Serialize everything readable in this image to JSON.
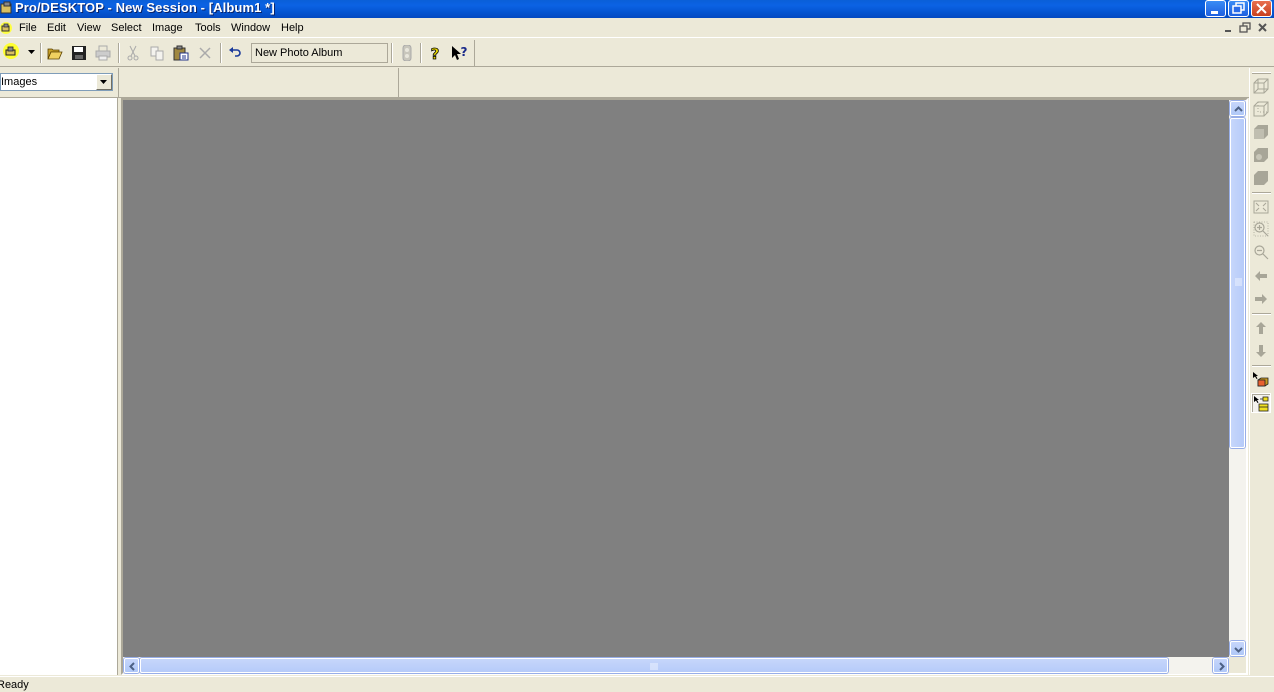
{
  "window": {
    "title": "Pro/DESKTOP - New Session - [Album1 *]",
    "controls": [
      "minimize",
      "restore",
      "close"
    ]
  },
  "menubar": {
    "items": [
      "File",
      "Edit",
      "View",
      "Select",
      "Image",
      "Tools",
      "Window",
      "Help"
    ],
    "mdi_controls": [
      "minimize",
      "restore",
      "close"
    ]
  },
  "toolbar": {
    "buttons": [
      {
        "name": "session-menu",
        "icon": "pro-desktop-logo-icon",
        "enabled": true
      },
      {
        "name": "open",
        "icon": "folder-open-icon",
        "enabled": true
      },
      {
        "name": "save",
        "icon": "floppy-disk-icon",
        "enabled": true
      },
      {
        "name": "print",
        "icon": "printer-icon",
        "enabled": false
      },
      {
        "name": "cut",
        "icon": "scissors-icon",
        "enabled": false
      },
      {
        "name": "copy",
        "icon": "copy-icon",
        "enabled": false
      },
      {
        "name": "paste",
        "icon": "clipboard-icon",
        "enabled": true
      },
      {
        "name": "delete",
        "icon": "delete-x-icon",
        "enabled": false
      },
      {
        "name": "undo",
        "icon": "undo-icon",
        "enabled": true
      },
      {
        "name": "traffic-light",
        "icon": "traffic-light-icon",
        "enabled": false
      },
      {
        "name": "help",
        "icon": "help-question-icon",
        "enabled": true
      },
      {
        "name": "context-help",
        "icon": "context-help-icon",
        "enabled": true
      }
    ],
    "album_name_field": "New Photo Album"
  },
  "left_panel": {
    "dropdown_selected": "Images"
  },
  "right_tools": [
    {
      "name": "wireframe-view",
      "icon": "wireframe-cube-icon"
    },
    {
      "name": "hidden-line-view",
      "icon": "hidden-line-cube-icon"
    },
    {
      "name": "shaded-view",
      "icon": "shaded-cube-icon"
    },
    {
      "name": "enhanced-shaded-view",
      "icon": "enhanced-shaded-cube-icon"
    },
    {
      "name": "solid-view",
      "icon": "solid-cube-icon"
    },
    {
      "name": "zoom-to-fit",
      "icon": "zoom-fit-icon"
    },
    {
      "name": "zoom-in-window",
      "icon": "zoom-in-icon"
    },
    {
      "name": "zoom-out",
      "icon": "zoom-out-icon"
    },
    {
      "name": "pan-left",
      "icon": "arrow-left-icon"
    },
    {
      "name": "pan-right",
      "icon": "arrow-right-icon"
    },
    {
      "name": "pan-up",
      "icon": "arrow-up-icon"
    },
    {
      "name": "pan-down",
      "icon": "arrow-down-icon"
    },
    {
      "name": "select-image",
      "icon": "select-box-icon"
    },
    {
      "name": "select-album",
      "icon": "select-stack-icon"
    }
  ],
  "status": {
    "text": "Ready"
  }
}
